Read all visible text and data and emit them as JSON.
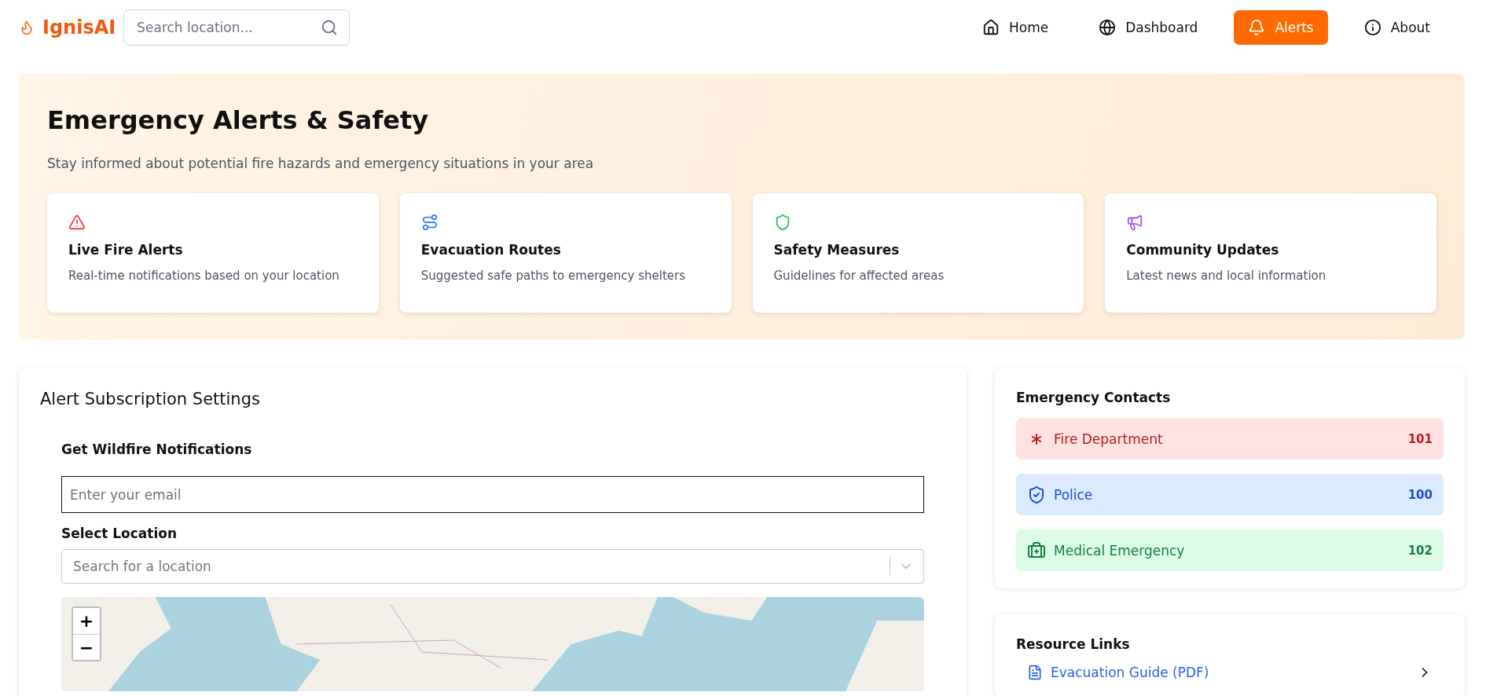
{
  "header": {
    "brand": "IgnisAI",
    "search": {
      "placeholder": "Search location..."
    },
    "nav": [
      {
        "label": "Home",
        "selected": false
      },
      {
        "label": "Dashboard",
        "selected": false
      },
      {
        "label": "Alerts",
        "selected": true
      },
      {
        "label": "About",
        "selected": false
      }
    ]
  },
  "hero": {
    "title": "Emergency Alerts & Safety",
    "subtitle": "Stay informed about potential fire hazards and emergency situations in your area",
    "cards": [
      {
        "title": "Live Fire Alerts",
        "text": "Real-time notifications based on your location"
      },
      {
        "title": "Evacuation Routes",
        "text": "Suggested safe paths to emergency shelters"
      },
      {
        "title": "Safety Measures",
        "text": "Guidelines for affected areas"
      },
      {
        "title": "Community Updates",
        "text": "Latest news and local information"
      }
    ]
  },
  "subscription": {
    "title": "Alert Subscription Settings",
    "section_title": "Get Wildfire Notifications",
    "email": {
      "placeholder": "Enter your email"
    },
    "location_label": "Select Location",
    "location_select": {
      "placeholder": "Search for a location"
    },
    "map": {
      "zoom_in": "+",
      "zoom_out": "−"
    }
  },
  "contacts": {
    "title": "Emergency Contacts",
    "items": [
      {
        "kind": "fire",
        "name": "Fire Department",
        "number": "101"
      },
      {
        "kind": "police",
        "name": "Police",
        "number": "100"
      },
      {
        "kind": "medical",
        "name": "Medical Emergency",
        "number": "102"
      }
    ]
  },
  "resources": {
    "title": "Resource Links",
    "links": [
      {
        "label": "Evacuation Guide (PDF)"
      }
    ]
  }
}
